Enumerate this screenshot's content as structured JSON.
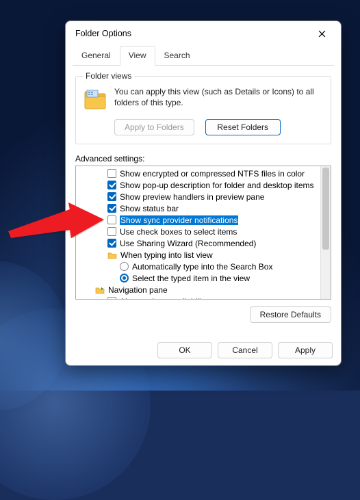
{
  "window": {
    "title": "Folder Options"
  },
  "tabs": {
    "general": "General",
    "view": "View",
    "search": "Search"
  },
  "folder_views": {
    "legend": "Folder views",
    "desc": "You can apply this view (such as Details or Icons) to all folders of this type.",
    "apply_btn": "Apply to Folders",
    "reset_btn": "Reset Folders"
  },
  "advanced": {
    "label": "Advanced settings:",
    "items": [
      {
        "kind": "cb",
        "checked": false,
        "label": "Show encrypted or compressed NTFS files in color"
      },
      {
        "kind": "cb",
        "checked": true,
        "label": "Show pop-up description for folder and desktop items"
      },
      {
        "kind": "cb",
        "checked": true,
        "label": "Show preview handlers in preview pane"
      },
      {
        "kind": "cb",
        "checked": true,
        "label": "Show status bar"
      },
      {
        "kind": "cb",
        "checked": false,
        "label": "Show sync provider notifications",
        "highlight": true
      },
      {
        "kind": "cb",
        "checked": false,
        "label": "Use check boxes to select items"
      },
      {
        "kind": "cb",
        "checked": true,
        "label": "Use Sharing Wizard (Recommended)"
      },
      {
        "kind": "grp",
        "icon": "folder",
        "label": "When typing into list view"
      },
      {
        "kind": "rb",
        "checked": false,
        "depth": 2,
        "label": "Automatically type into the Search Box"
      },
      {
        "kind": "rb",
        "checked": true,
        "depth": 2,
        "label": "Select the typed item in the view"
      },
      {
        "kind": "grp",
        "icon": "nav",
        "depth": 0,
        "label": "Navigation pane"
      },
      {
        "kind": "cb",
        "checked": false,
        "label": "Always show availability status"
      }
    ],
    "restore_btn": "Restore Defaults"
  },
  "footer": {
    "ok": "OK",
    "cancel": "Cancel",
    "apply": "Apply"
  }
}
